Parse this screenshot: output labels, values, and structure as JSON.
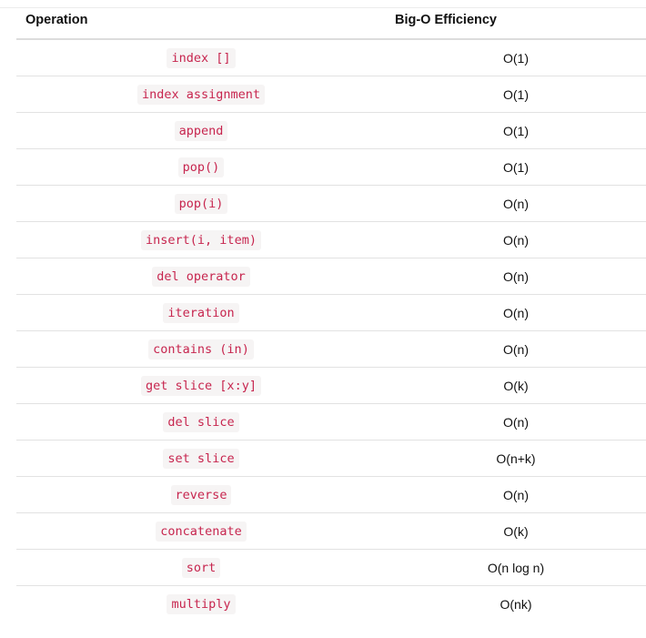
{
  "table": {
    "headers": [
      "Operation",
      "Big-O Efficiency"
    ],
    "rows": [
      {
        "operation": "index []",
        "efficiency": "O(1)"
      },
      {
        "operation": "index assignment",
        "efficiency": "O(1)"
      },
      {
        "operation": "append",
        "efficiency": "O(1)"
      },
      {
        "operation": "pop()",
        "efficiency": "O(1)"
      },
      {
        "operation": "pop(i)",
        "efficiency": "O(n)"
      },
      {
        "operation": "insert(i, item)",
        "efficiency": "O(n)"
      },
      {
        "operation": "del operator",
        "efficiency": "O(n)"
      },
      {
        "operation": "iteration",
        "efficiency": "O(n)"
      },
      {
        "operation": "contains (in)",
        "efficiency": "O(n)"
      },
      {
        "operation": "get slice [x:y]",
        "efficiency": "O(k)"
      },
      {
        "operation": "del slice",
        "efficiency": "O(n)"
      },
      {
        "operation": "set slice",
        "efficiency": "O(n+k)"
      },
      {
        "operation": "reverse",
        "efficiency": "O(n)"
      },
      {
        "operation": "concatenate",
        "efficiency": "O(k)"
      },
      {
        "operation": "sort",
        "efficiency": "O(n log n)"
      },
      {
        "operation": "multiply",
        "efficiency": "O(nk)"
      }
    ]
  },
  "colors": {
    "code_text": "#c7254e",
    "code_background": "#f6f4f4",
    "header_rule": "#dcdcdc",
    "row_rule": "#e2e2e2"
  }
}
